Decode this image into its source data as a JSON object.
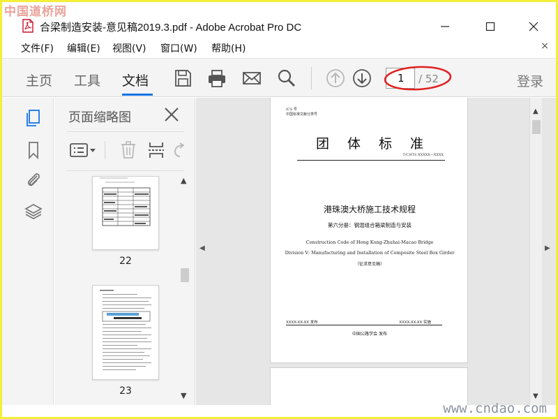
{
  "watermark": {
    "top": "中国道桥网",
    "bottom": "www.cndao.com"
  },
  "window": {
    "title": "合梁制造安装-意见稿2019.3.pdf - Adobe Acrobat Pro DC"
  },
  "menu": {
    "items": [
      "文件(F)",
      "编辑(E)",
      "视图(V)",
      "窗口(W)",
      "帮助(H)"
    ],
    "close": "×"
  },
  "toolbar": {
    "tabs": [
      "主页",
      "工具",
      "文档"
    ],
    "active_tab": "文档",
    "page_current": "1",
    "page_total": "/ 52",
    "login": "登录"
  },
  "sidebar": {
    "panel_title": "页面缩略图",
    "thumbnails": [
      {
        "label": "22"
      },
      {
        "label": "23"
      }
    ]
  },
  "document": {
    "page1": {
      "num": "ICS 号",
      "org": "中国标准文献分类号",
      "heading": "团体标准",
      "code": "T/CHTS XXXXX—XXXX",
      "title": "港珠澳大桥施工技术规程",
      "subtitle": "第六分册：钢混组合箱梁制造与安装",
      "english1": "Construction Code of Hong Kong-Zhuhai-Macao Bridge",
      "english2": "Division Ⅴ: Manufacturing and Installation of Composite Steel Box Girder",
      "draft": "（征求意见稿）",
      "issue": "XXXX-XX-XX 发布",
      "implement": "XXXX-XX-XX 实施",
      "publisher": "中国公路学会  发布"
    }
  },
  "colors": {
    "accent": "#1473e6",
    "frame": "#f3ef3a",
    "annotation": "#e02020"
  }
}
